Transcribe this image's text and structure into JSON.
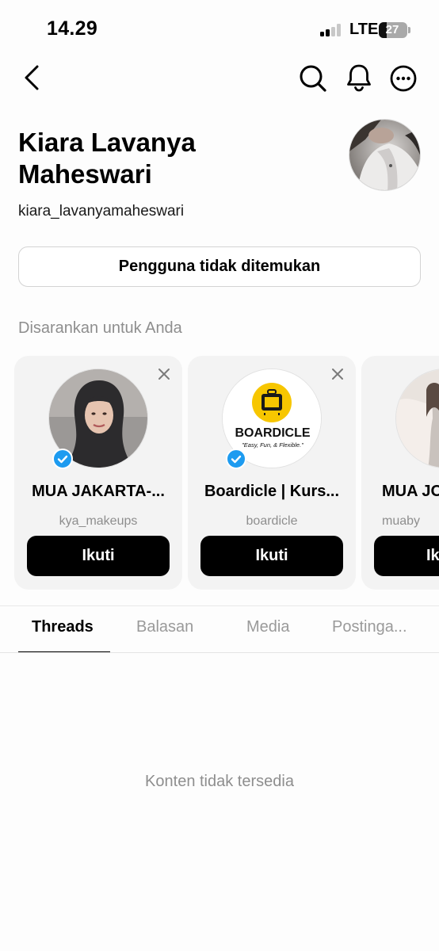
{
  "status_bar": {
    "time": "14.29",
    "network": "LTE",
    "battery": "27",
    "battery_level_percent": 27,
    "signal_bars_active": 2,
    "signal_bars_total": 4
  },
  "nav": {
    "back_icon": "chevron-left-icon",
    "search_icon": "search-icon",
    "notifications_icon": "bell-icon",
    "more_icon": "more-horizontal-circle-icon"
  },
  "profile": {
    "name": "Kiara Lavanya Maheswari",
    "handle": "kiara_lavanyamaheswari",
    "status_button": "Pengguna tidak ditemukan"
  },
  "suggestions": {
    "title": "Disarankan untuk Anda",
    "cards": [
      {
        "name": "MUA JAKARTA-...",
        "username": "kya_makeups",
        "follow": "Ikuti",
        "verified": true
      },
      {
        "name": "Boardicle | Kurs...",
        "username": "boardicle",
        "follow": "Ikuti",
        "verified": true,
        "logo_text": "BOARDICLE",
        "logo_tagline": "\"Easy, Fun, & Flexible.\""
      },
      {
        "name": "MUA JO",
        "username": "muaby",
        "follow": "Ik",
        "verified": false
      }
    ]
  },
  "tabs": {
    "items": [
      {
        "label": "Threads",
        "active": true
      },
      {
        "label": "Balasan",
        "active": false
      },
      {
        "label": "Media",
        "active": false
      },
      {
        "label": "Postinga...",
        "active": false
      }
    ]
  },
  "content": {
    "empty_text": "Konten tidak tersedia"
  },
  "colors": {
    "verified_badge": "#1d9bf0",
    "boardicle_yellow": "#f7c600",
    "follow_button": "#000000",
    "muted_text": "#8e8e8e",
    "card_background": "#f3f3f3"
  }
}
